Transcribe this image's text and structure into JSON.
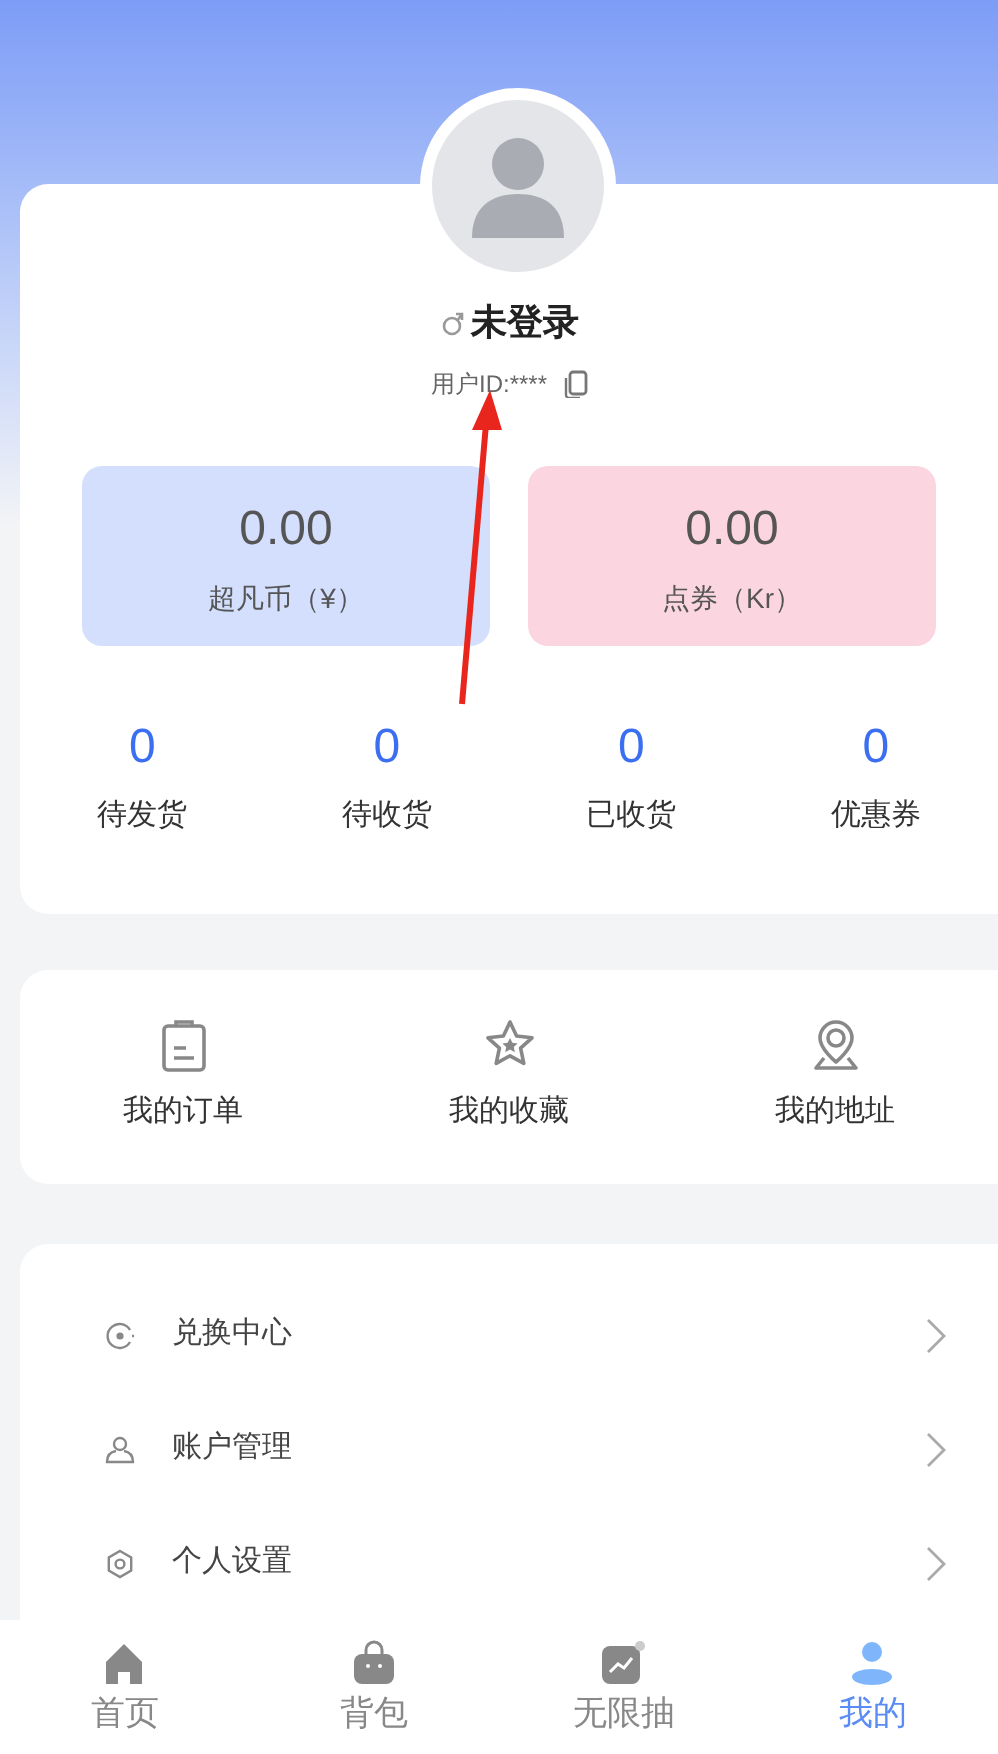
{
  "profile": {
    "name": "未登录",
    "user_id": "用户ID:****"
  },
  "balances": [
    {
      "kind": "coins",
      "value": "0.00",
      "label": "超凡币（¥）"
    },
    {
      "kind": "vouchers",
      "value": "0.00",
      "label": "点券（Kr）"
    }
  ],
  "order_counts": [
    {
      "count": "0",
      "label": "待发货"
    },
    {
      "count": "0",
      "label": "待收货"
    },
    {
      "count": "0",
      "label": "已收货"
    },
    {
      "count": "0",
      "label": "优惠券"
    }
  ],
  "shortcuts": [
    {
      "kind": "orders",
      "label": "我的订单"
    },
    {
      "kind": "favorites",
      "label": "我的收藏"
    },
    {
      "kind": "address",
      "label": "我的地址"
    }
  ],
  "menu": [
    {
      "kind": "exchange",
      "label": "兑换中心"
    },
    {
      "kind": "account",
      "label": "账户管理"
    },
    {
      "kind": "settings",
      "label": "个人设置"
    }
  ],
  "tabs": [
    {
      "kind": "home",
      "label": "首页",
      "selected": false
    },
    {
      "kind": "bag",
      "label": "背包",
      "selected": false
    },
    {
      "kind": "draw",
      "label": "无限抽",
      "selected": false
    },
    {
      "kind": "me",
      "label": "我的",
      "selected": true
    }
  ]
}
